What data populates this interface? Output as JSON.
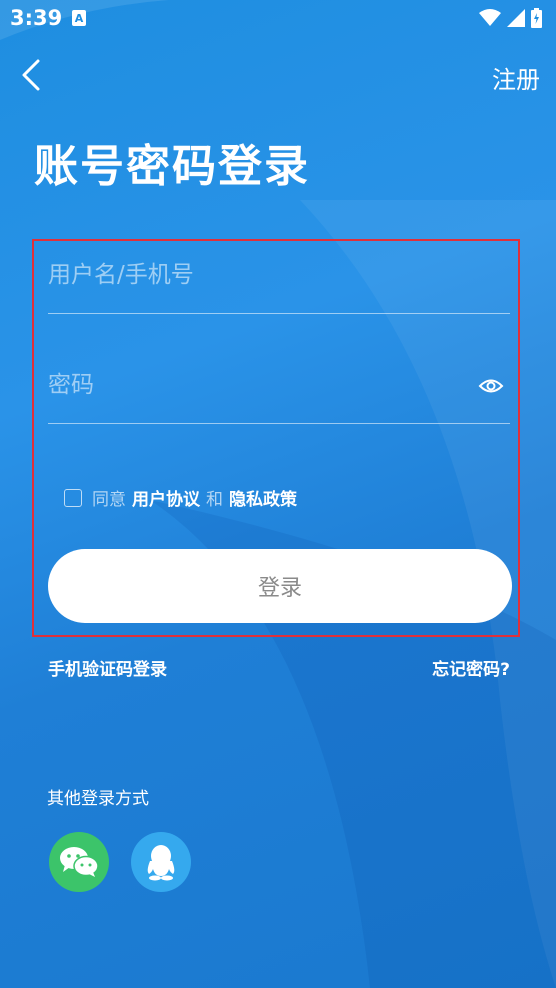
{
  "status_bar": {
    "time": "3:39",
    "app_icon_letter": "A"
  },
  "header": {
    "register_label": "注册"
  },
  "page": {
    "title": "账号密码登录"
  },
  "form": {
    "username_placeholder": "用户名/手机号",
    "password_placeholder": "密码",
    "agree_prefix": "同意",
    "user_agreement": "用户协议",
    "and": "和",
    "privacy_policy": "隐私政策",
    "login_label": "登录"
  },
  "links": {
    "sms_login": "手机验证码登录",
    "forgot_password": "忘记密码?"
  },
  "other_login": {
    "title": "其他登录方式",
    "options": [
      "wechat-icon",
      "qq-icon"
    ]
  },
  "colors": {
    "background": "#1e8ee0",
    "highlight_border": "#e0303a",
    "wechat": "#3cc46a",
    "qq": "#35a9ee"
  }
}
